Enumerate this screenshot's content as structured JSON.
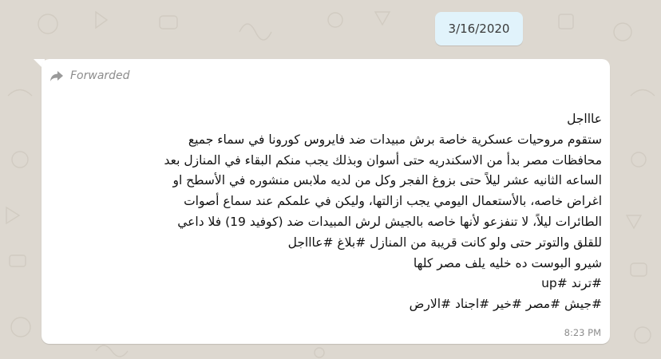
{
  "date_chip": "3/16/2020",
  "message": {
    "forwarded_label": "Forwarded",
    "icon": "forward-arrow-icon",
    "lines": [
      "عاااجل",
      "ستقوم مروحيات عسكرية خاصة برش مبيدات ضد فايروس كورونا في سماء جميع",
      "محافظات مصر بدأ من الاسكندريه حتى أسوان  وبذلك يجب منكم البقاء في المنازل بعد",
      "الساعه الثانيه عشر ليلاً  حتى بزوغ الفجر وكل من لديه ملابس منشوره في الأسطح او",
      "اغراض خاصه، بالأستعمال اليومي يجب ازالتها، وليكن في علمكم عند سماع أصوات",
      "الطائرات ليلاً، لا تنفزعو لأنها خاصه بالجيش  لرش المبيدات ضد (كوفيد 19)  فلا داعي",
      "للقلق والتوتر  حتى ولو كانت قريبة من المنازل  #بلاغ #عاااجل",
      "شيرو البوست ده خليه يلف مصر كلها",
      "#ترند #up",
      "#جيش #مصر #خير #اجناد #الارض"
    ],
    "time": "8:23 PM"
  },
  "colors": {
    "wallpaper": "#ddd8d0",
    "date_chip": "#e1f3fb",
    "bubble": "#ffffff",
    "meta_text": "#8c8c8c"
  }
}
